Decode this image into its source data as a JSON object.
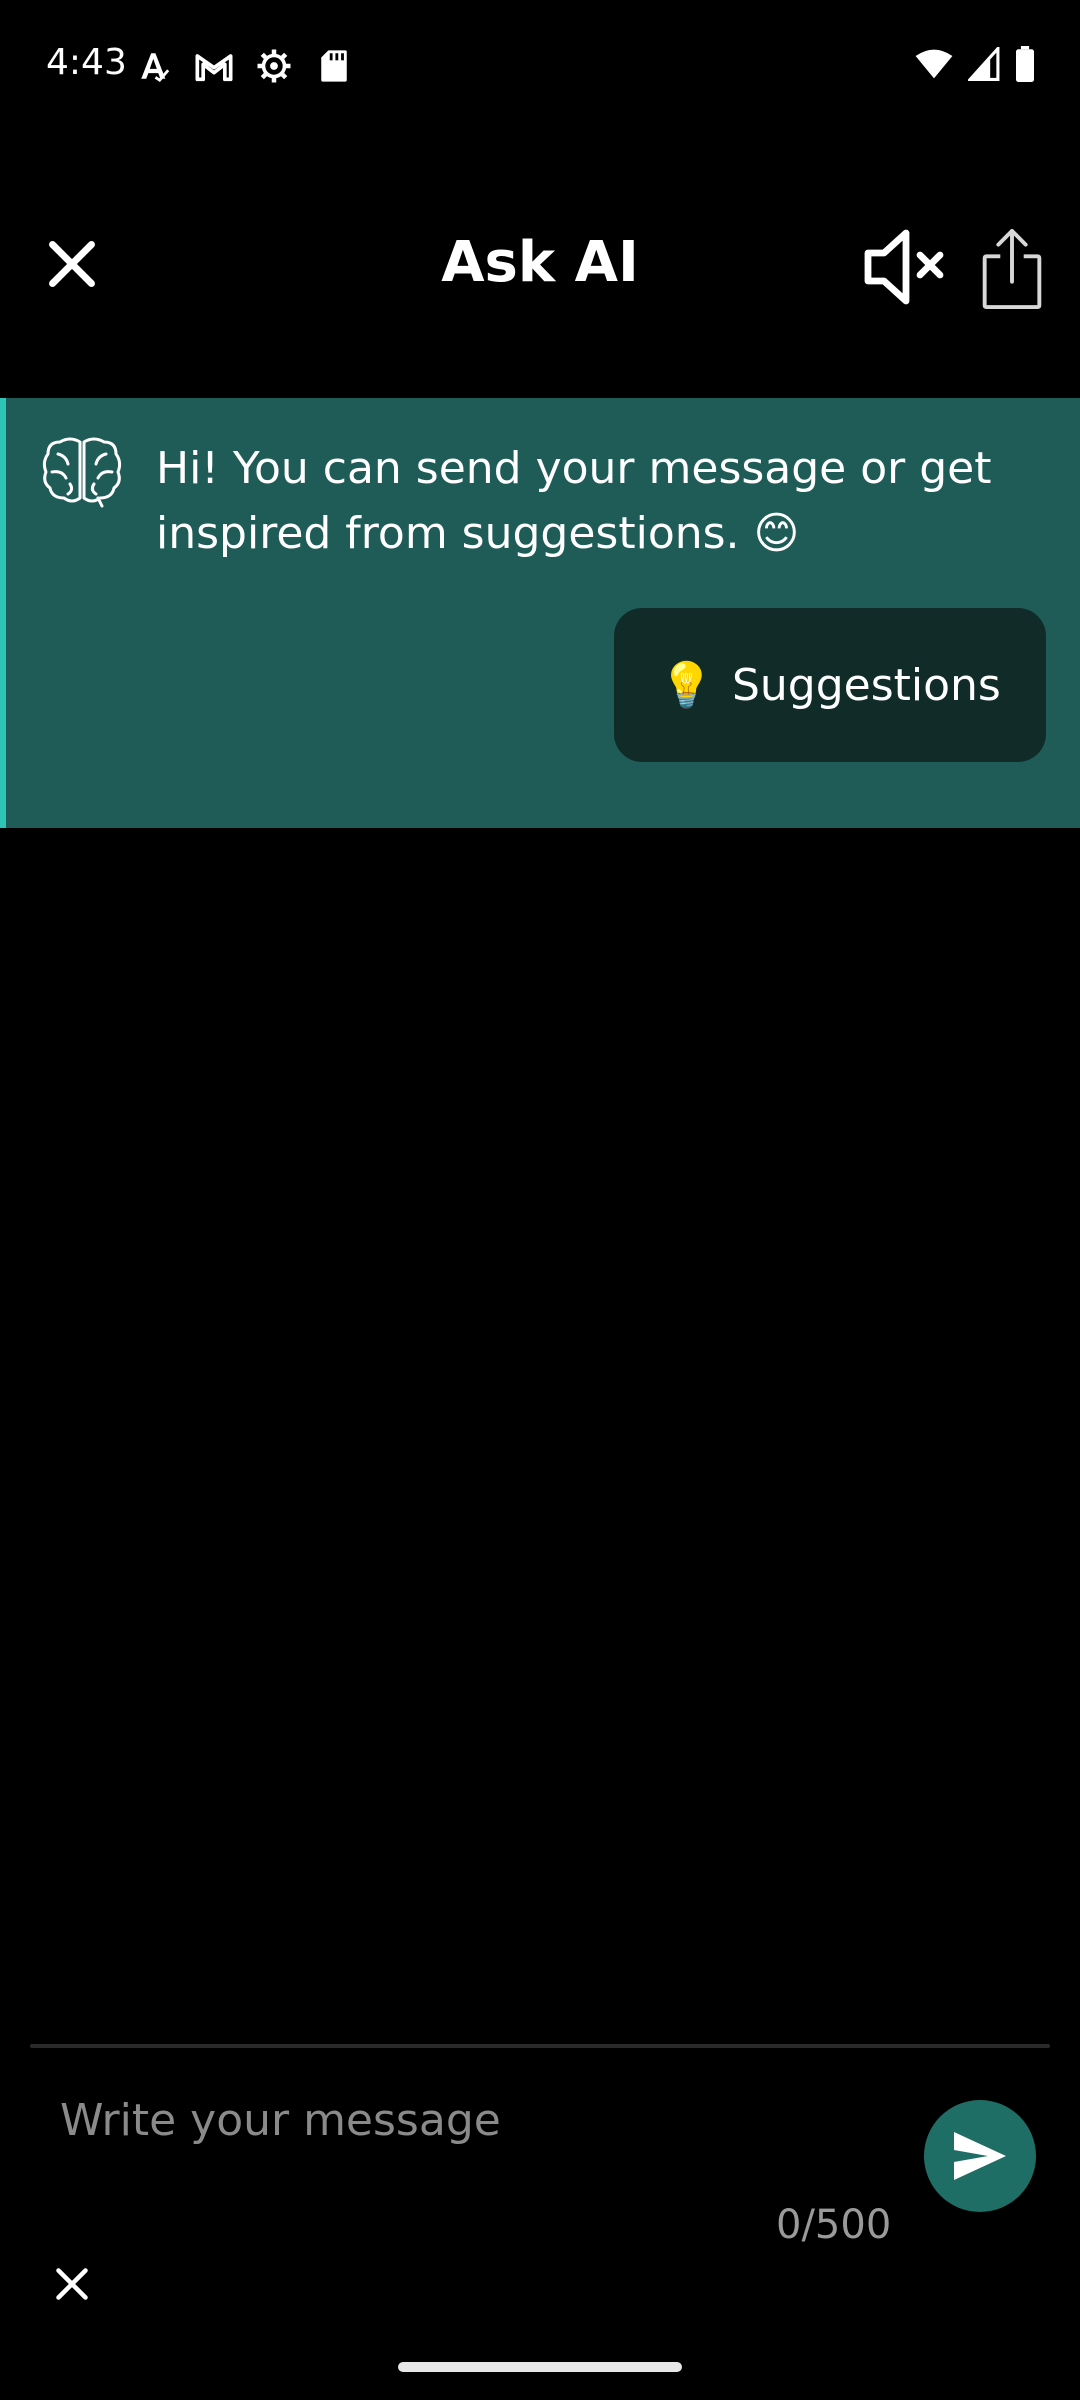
{
  "status_bar": {
    "time": "4:43",
    "left_icons": [
      "font-icon",
      "gmail-icon",
      "gear-icon",
      "sd-card-icon"
    ],
    "right_icons": [
      "wifi-icon",
      "signal-icon",
      "battery-icon"
    ]
  },
  "header": {
    "title": "Ask AI",
    "close_icon": "close-icon",
    "mute_icon": "volume-mute-icon",
    "share_icon": "share-icon"
  },
  "ai_message": {
    "avatar_icon": "brain-icon",
    "text": "Hi! You can send your message or get inspired from suggestions. 😊",
    "suggestions_emoji": "💡",
    "suggestions_label": "Suggestions"
  },
  "composer": {
    "placeholder": "Write your message",
    "value": "",
    "char_count": "0/500",
    "send_icon": "send-icon",
    "clear_icon": "close-icon"
  },
  "colors": {
    "background": "#000000",
    "card_background": "#1f5c58",
    "card_accent": "#2ec4b6",
    "suggestions_background": "#112b29",
    "send_button": "#1f6e66"
  }
}
